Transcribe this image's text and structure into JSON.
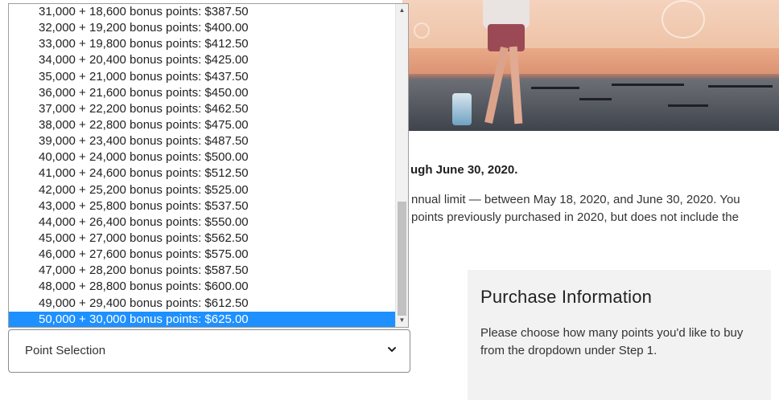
{
  "page": {
    "heading_fragment": "ugh June 30, 2020.",
    "paragraph_lines": [
      "nnual limit — between May 18, 2020, and June 30, 2020. You",
      "points previously purchased in 2020, but does not include the"
    ]
  },
  "dropdown": {
    "options": [
      "31,000 + 18,600 bonus points: $387.50",
      "32,000 + 19,200 bonus points: $400.00",
      "33,000 + 19,800 bonus points: $412.50",
      "34,000 + 20,400 bonus points: $425.00",
      "35,000 + 21,000 bonus points: $437.50",
      "36,000 + 21,600 bonus points: $450.00",
      "37,000 + 22,200 bonus points: $462.50",
      "38,000 + 22,800 bonus points: $475.00",
      "39,000 + 23,400 bonus points: $487.50",
      "40,000 + 24,000 bonus points: $500.00",
      "41,000 + 24,600 bonus points: $512.50",
      "42,000 + 25,200 bonus points: $525.00",
      "43,000 + 25,800 bonus points: $537.50",
      "44,000 + 26,400 bonus points: $550.00",
      "45,000 + 27,000 bonus points: $562.50",
      "46,000 + 27,600 bonus points: $575.00",
      "47,000 + 28,200 bonus points: $587.50",
      "48,000 + 28,800 bonus points: $600.00",
      "49,000 + 29,400 bonus points: $612.50",
      "50,000 + 30,000 bonus points: $625.00"
    ],
    "highlighted_index": 19,
    "highlight_color": "#1e90ff"
  },
  "select": {
    "current_value": "Point Selection"
  },
  "purchase_info": {
    "title": "Purchase Information",
    "body": "Please choose how many points you'd like to buy from the dropdown under Step 1."
  },
  "icons": {
    "select_chevron": "chevron-down-icon",
    "scroll_up": "scroll-up-arrow-icon",
    "scroll_down": "scroll-down-arrow-icon"
  }
}
